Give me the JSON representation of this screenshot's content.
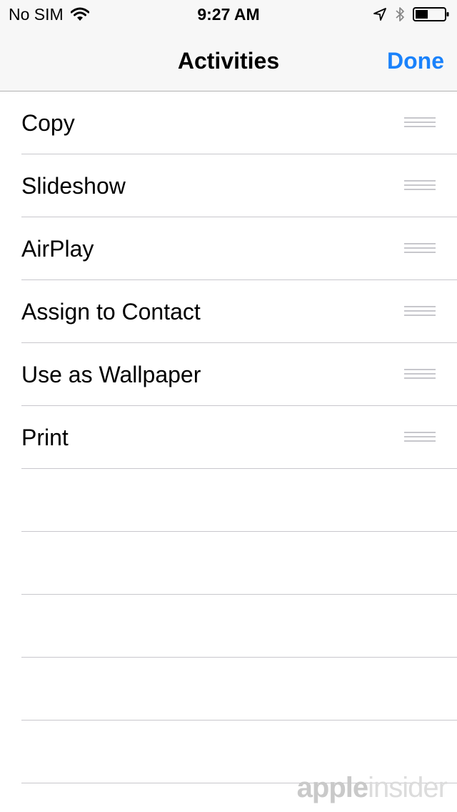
{
  "status_bar": {
    "carrier": "No SIM",
    "time": "9:27 AM",
    "icons": [
      "wifi-icon",
      "location-arrow-icon",
      "bluetooth-icon",
      "battery-icon"
    ]
  },
  "nav": {
    "title": "Activities",
    "done_label": "Done"
  },
  "activities": [
    {
      "label": "Copy"
    },
    {
      "label": "Slideshow"
    },
    {
      "label": "AirPlay"
    },
    {
      "label": "Assign to Contact"
    },
    {
      "label": "Use as Wallpaper"
    },
    {
      "label": "Print"
    }
  ],
  "watermark": {
    "part1": "apple",
    "part2": "insider"
  },
  "colors": {
    "accent": "#1a82fb",
    "separator": "#c8c7cc",
    "navbar_bg": "#f7f7f7",
    "handle": "#c7c7cc"
  }
}
